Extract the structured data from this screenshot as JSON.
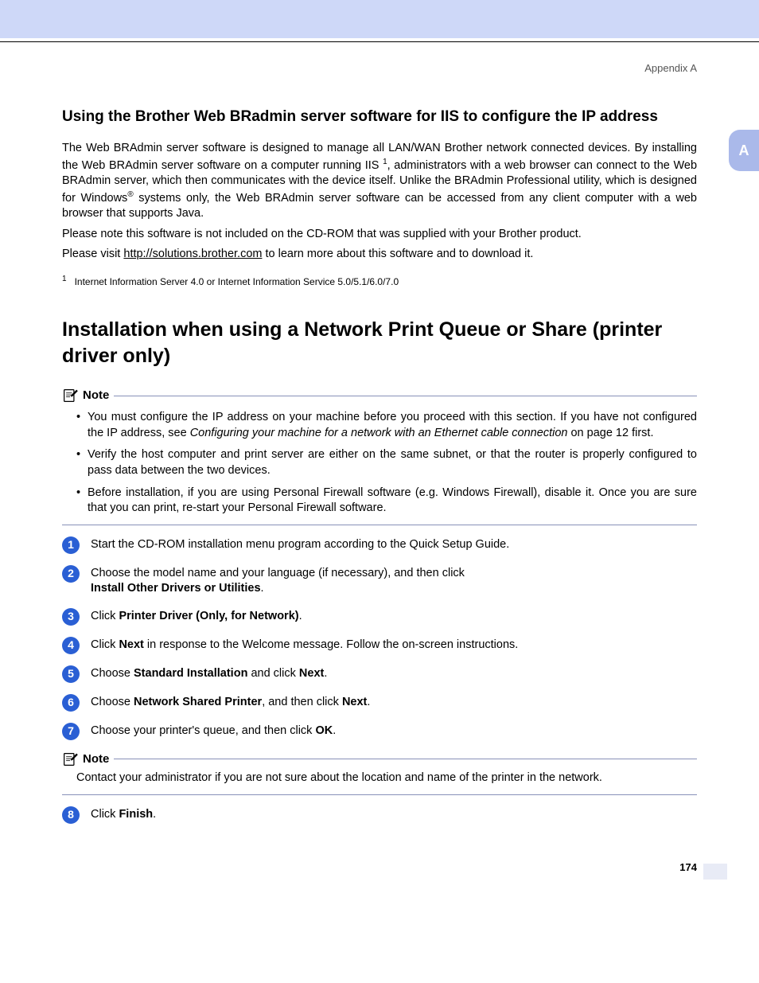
{
  "header": {
    "appendix": "Appendix A",
    "side_tab": "A"
  },
  "section1": {
    "title": "Using the Brother Web BRadmin server software for IIS to configure the IP address",
    "p1a": "The Web BRAdmin server software is designed to manage all LAN/WAN Brother network connected devices. By installing the Web BRAdmin server software on a computer running IIS ",
    "p1b": ", administrators with a web browser can connect to the Web BRAdmin server, which then communicates with the device itself. Unlike the BRAdmin Professional utility, which is designed for Windows",
    "p1c": " systems only, the Web BRAdmin server software can be accessed from any client computer with a web browser that supports Java.",
    "p2": "Please note this software is not included on the CD-ROM that was supplied with your Brother product.",
    "p3a": "Please visit ",
    "link": "http://solutions.brother.com",
    "p3b": " to learn more about this software and to download it.",
    "footnote": "Internet Information Server 4.0 or Internet Information Service 5.0/5.1/6.0/7.0"
  },
  "section2": {
    "title": "Installation when using a Network Print Queue or Share (printer driver only)",
    "note1_label": "Note",
    "note1_bullets": [
      {
        "pre": "You must configure the IP address on your machine before you proceed with this section. If you have not configured the IP address, see ",
        "italic": "Configuring your machine for a network with an Ethernet cable connection",
        "post": " on page 12 first."
      },
      {
        "pre": "Verify the host computer and print server are either on the same subnet, or that the router is properly configured to pass data between the two devices.",
        "italic": "",
        "post": ""
      },
      {
        "pre": "Before installation, if you are using Personal Firewall software (e.g. Windows Firewall), disable it. Once you are sure that you can print, re-start your Personal Firewall software.",
        "italic": "",
        "post": ""
      }
    ],
    "steps": {
      "s1": "Start the CD-ROM installation menu program according to the Quick Setup Guide.",
      "s2a": "Choose the model name and your language (if necessary), and then click",
      "s2b": "Install Other Drivers or Utilities",
      "s3a": "Click ",
      "s3b": "Printer Driver (Only, for Network)",
      "s4a": "Click ",
      "s4b": "Next",
      "s4c": " in response to the Welcome message. Follow the on-screen instructions.",
      "s5a": "Choose ",
      "s5b": "Standard Installation",
      "s5c": " and click ",
      "s5d": "Next",
      "s6a": "Choose ",
      "s6b": "Network Shared Printer",
      "s6c": ", and then click ",
      "s6d": "Next",
      "s7a": "Choose your printer's queue, and then click ",
      "s7b": "OK",
      "s8a": "Click ",
      "s8b": "Finish"
    },
    "note2_label": "Note",
    "note2_text": "Contact your administrator if you are not sure about the location and name of the printer in the network."
  },
  "footer": {
    "page_number": "174"
  }
}
